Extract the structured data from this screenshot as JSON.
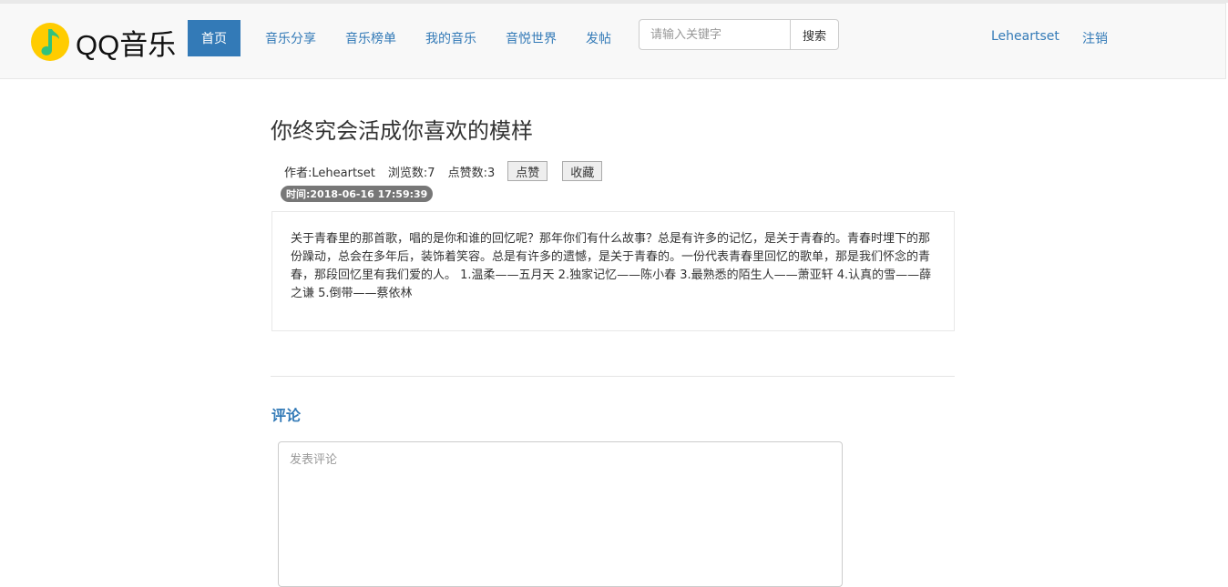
{
  "brand": {
    "logo_text": "QQ音乐",
    "accent": "#337ab7",
    "logo_yellow": "#ffcc00",
    "logo_green": "#31c27c"
  },
  "nav": {
    "active": "首页",
    "links": [
      "音乐分享",
      "音乐榜单",
      "我的音乐",
      "音悦世界",
      "发帖"
    ],
    "search_placeholder": "请输入关键字",
    "search_button": "搜索",
    "user": "Leheartset",
    "logout": "注销"
  },
  "post": {
    "title": "你终究会活成你喜欢的模样",
    "author": "作者:Leheartset",
    "views": "浏览数:7",
    "likes": "点赞数:3",
    "like_button": "点赞",
    "favorite_button": "收藏",
    "time": "时间:2018-06-16 17:59:39",
    "body": "关于青春里的那首歌，唱的是你和谁的回忆呢？那年你们有什么故事？总是有许多的记忆，是关于青春的。青春时埋下的那份躁动，总会在多年后，装饰着笑容。总是有许多的遗憾，是关于青春的。一份代表青春里回忆的歌单，那是我们怀念的青春，那段回忆里有我们爱的人。 1.温柔——五月天 2.独家记忆——陈小春 3.最熟悉的陌生人——萧亚轩 4.认真的雪——薛之谦 5.倒带——蔡依林"
  },
  "comments": {
    "heading": "评论",
    "placeholder": "发表评论"
  }
}
